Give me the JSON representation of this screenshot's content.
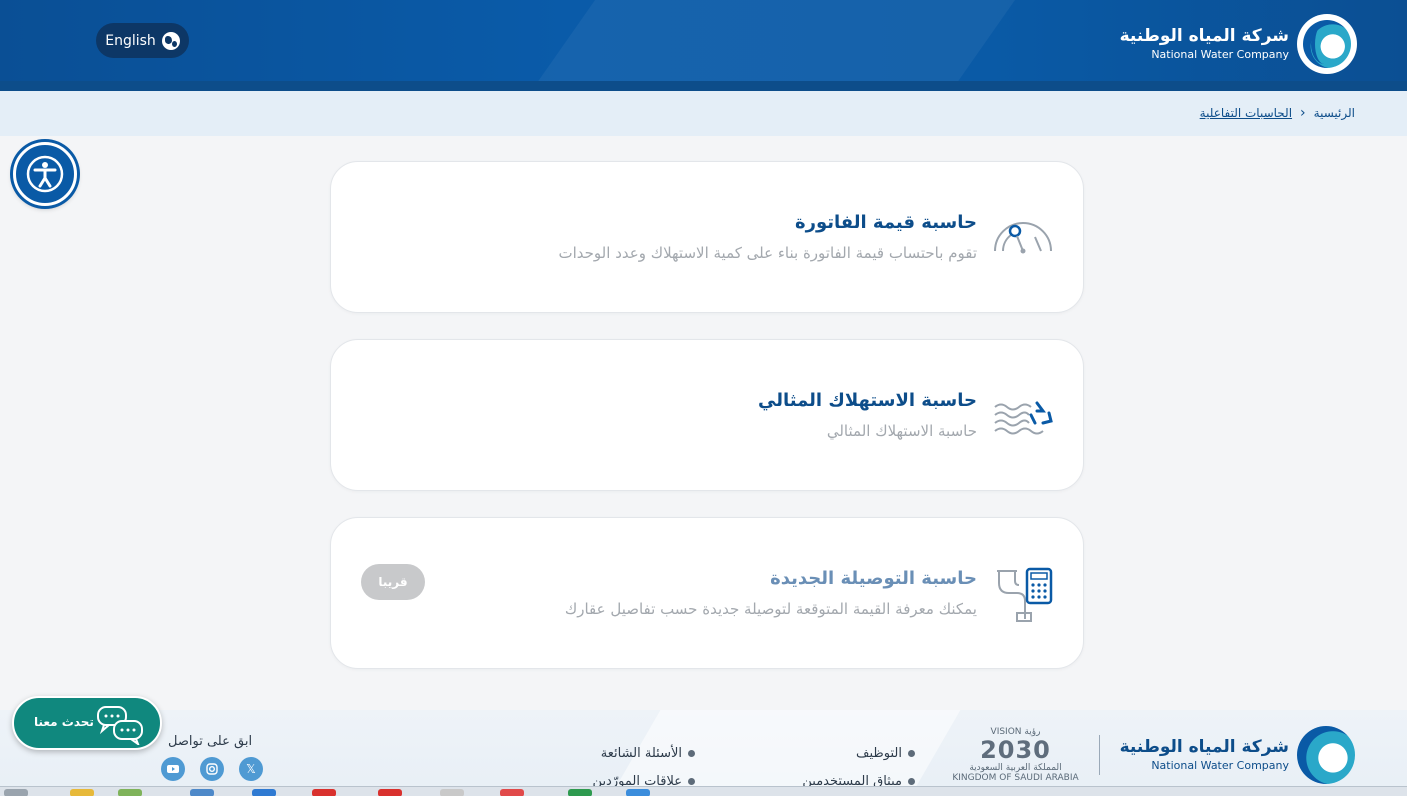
{
  "header": {
    "language_button": "English",
    "brand_ar": "شركة المياه الوطنية",
    "brand_en": "National Water Company"
  },
  "breadcrumb": {
    "home": "الرئيسية",
    "current": "الحاسبات التفاعلية"
  },
  "cards": [
    {
      "title": "حاسبة قيمة الفاتورة",
      "description": "تقوم باحتساب قيمة الفاتورة بناء على كمية الاستهلاك وعدد الوحدات",
      "icon": "gauge-icon"
    },
    {
      "title": "حاسبة الاستهلاك المثالي",
      "description": "حاسبة الاستهلاك المثالي",
      "icon": "water-recycle-icon"
    },
    {
      "title": "حاسبة التوصيلة الجديدة",
      "description": "يمكنك معرفة القيمة المتوقعة لتوصيلة جديدة حسب تفاصيل عقارك",
      "icon": "pipe-calculator-icon",
      "badge": "قريبا"
    }
  ],
  "footer": {
    "brand_ar": "شركة المياه الوطنية",
    "brand_en": "National Water Company",
    "vision_top": "VISION رؤية",
    "vision_year": "2030",
    "vision_sub": "المملكة العربية السعودية",
    "vision_kingdom": "KINGDOM OF SAUDI ARABIA",
    "links": [
      "التوظيف",
      "الأسئلة الشائعة",
      "ميثاق المستخدمين",
      "علاقات المورّدين"
    ],
    "stay_connected": "ابق على تواصل",
    "social": [
      "x-icon",
      "instagram-icon",
      "youtube-icon"
    ]
  },
  "chat": {
    "label": "تحدث معنا"
  },
  "colors": {
    "primary": "#0a5aa6",
    "chat": "#10887e",
    "muted": "#a3a8ae"
  }
}
